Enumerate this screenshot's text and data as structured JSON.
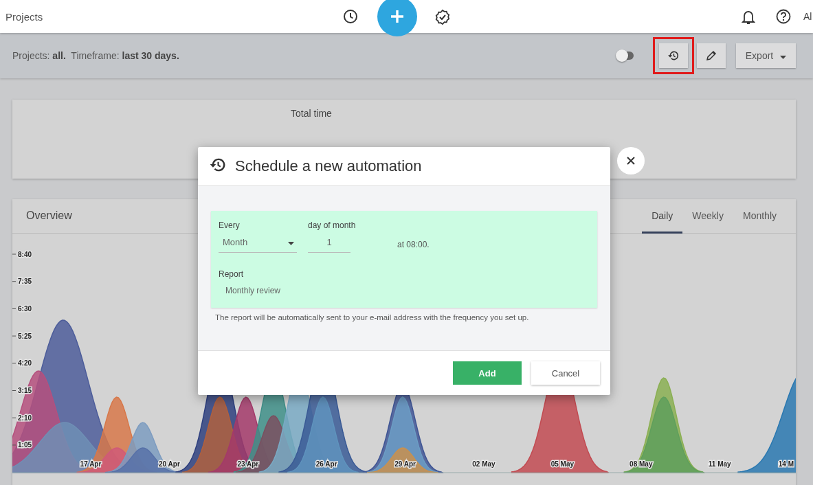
{
  "topbar": {
    "title": "Projects",
    "user_text": "Al"
  },
  "filter_bar": {
    "summary": "Projects: **all.**  Timeframe: **last 30 days.**",
    "toggle_on": false,
    "history_highlighted": true,
    "export_label": "Export"
  },
  "total_card": {
    "title": "Total time"
  },
  "overview": {
    "title": "Overview",
    "tabs": [
      {
        "label": "Daily",
        "selected": true
      },
      {
        "label": "Weekly",
        "selected": false
      },
      {
        "label": "Monthly",
        "selected": false
      }
    ],
    "y_ticks": [
      "8:40",
      "7:35",
      "6:30",
      "5:25",
      "4:20",
      "3:15",
      "2:10",
      "1:05"
    ],
    "x_labels": [
      "17 Apr",
      "20 Apr",
      "23 Apr",
      "26 Apr",
      "29 Apr",
      "02 May",
      "05 May",
      "08 May",
      "11 May",
      "14 M"
    ]
  },
  "dialog": {
    "title": "Schedule a new automation",
    "every_label": "Every",
    "every_value": "Month",
    "day_label": "day of month",
    "day_value": "1",
    "time_text": "at 08:00.",
    "report_label": "Report",
    "report_value": "Monthly review",
    "note": "The report will be automatically sent to your e-mail address with the frequency you set up.",
    "buttons": [
      {
        "label": "Add",
        "kind": "primary"
      },
      {
        "label": "Cancel",
        "kind": "secondary"
      }
    ]
  }
}
